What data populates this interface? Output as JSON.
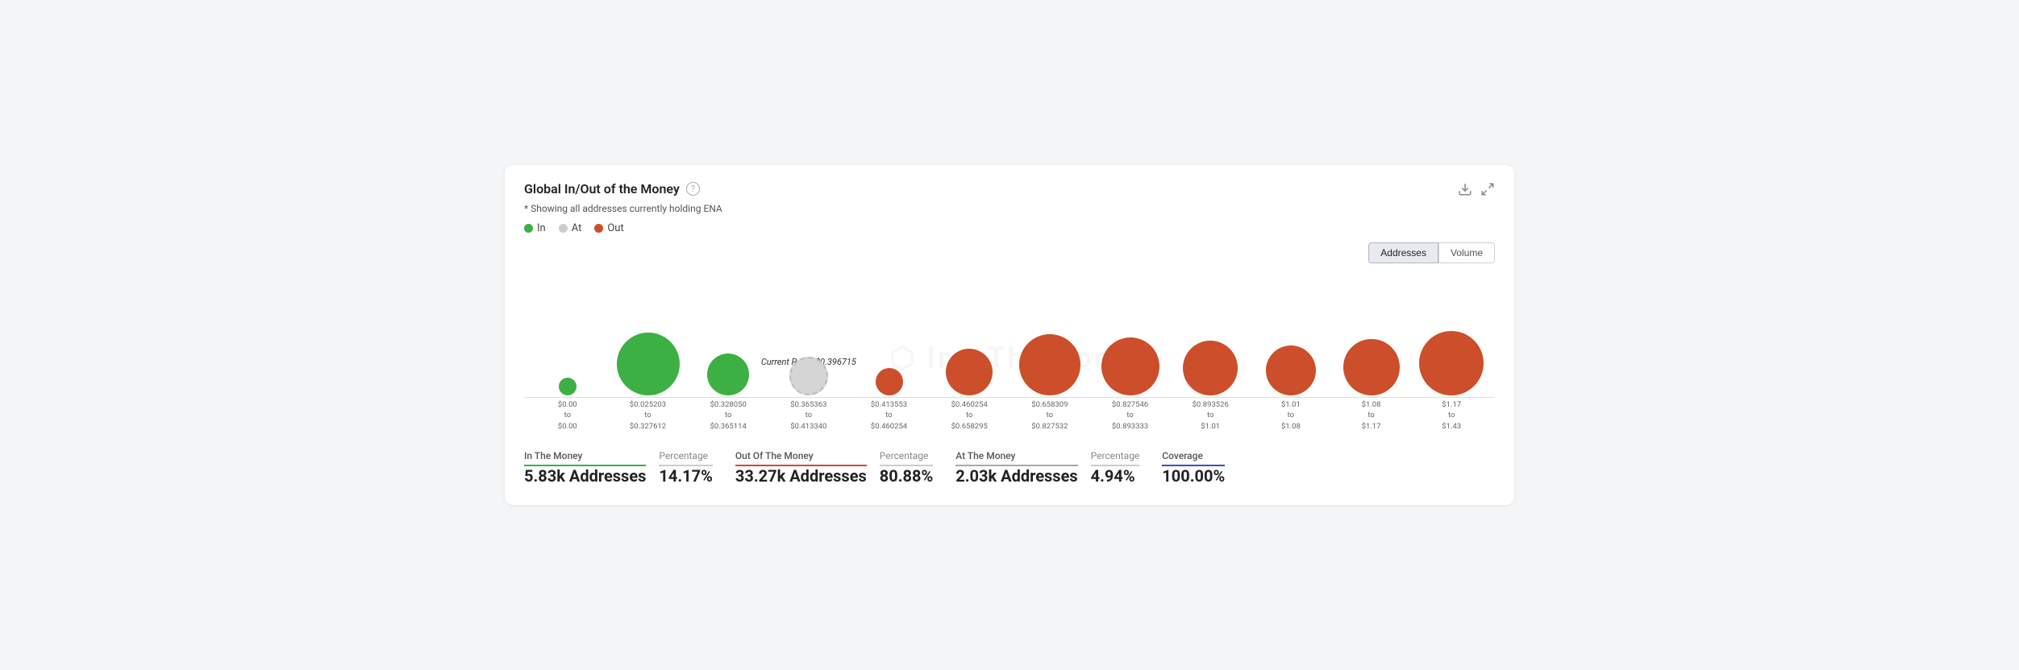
{
  "header": {
    "title": "Global In/Out of the Money",
    "subtitle": "* Showing all addresses currently holding ENA"
  },
  "legend": {
    "items": [
      {
        "label": "In",
        "color": "green"
      },
      {
        "label": "At",
        "color": "gray"
      },
      {
        "label": "Out",
        "color": "red"
      }
    ]
  },
  "tabs": {
    "options": [
      "Addresses",
      "Volume"
    ],
    "active": "Addresses"
  },
  "chart": {
    "current_price_label": "Current Price: $0.396715",
    "bubbles": [
      {
        "color": "green",
        "size": 22,
        "range_top": "$0.00",
        "range_bottom": "$0.00"
      },
      {
        "color": "green",
        "size": 78,
        "range_top": "$0.025203",
        "range_bottom": "$0.327612"
      },
      {
        "color": "green",
        "size": 52,
        "range_top": "$0.328050",
        "range_bottom": "$0.365114"
      },
      {
        "color": "gray",
        "size": 48,
        "range_top": "$0.365363",
        "range_bottom": "$0.413340",
        "price_col": true
      },
      {
        "color": "red",
        "size": 34,
        "range_top": "$0.413553",
        "range_bottom": "$0.460254"
      },
      {
        "color": "red",
        "size": 58,
        "range_top": "$0.460254",
        "range_bottom": "$0.658295"
      },
      {
        "color": "red",
        "size": 76,
        "range_top": "$0.658309",
        "range_bottom": "$0.827532"
      },
      {
        "color": "red",
        "size": 72,
        "range_top": "$0.827546",
        "range_bottom": "$0.893333"
      },
      {
        "color": "red",
        "size": 68,
        "range_top": "$0.893526",
        "range_bottom": "$1.01"
      },
      {
        "color": "red",
        "size": 62,
        "range_top": "$1.01",
        "range_bottom": "$1.08"
      },
      {
        "color": "red",
        "size": 70,
        "range_top": "$1.08",
        "range_bottom": "$1.17"
      },
      {
        "color": "red",
        "size": 80,
        "range_top": "$1.17",
        "range_bottom": "$1.43"
      }
    ],
    "x_labels": [
      {
        "line1": "$0.00",
        "line2": "to",
        "line3": "$0.00"
      },
      {
        "line1": "$0.025203",
        "line2": "to",
        "line3": "$0.327612"
      },
      {
        "line1": "$0.328050",
        "line2": "to",
        "line3": "$0.365114"
      },
      {
        "line1": "$0.365363",
        "line2": "to",
        "line3": "$0.413340"
      },
      {
        "line1": "$0.413553",
        "line2": "to",
        "line3": "$0.460254"
      },
      {
        "line1": "$0.460254",
        "line2": "to",
        "line3": "$0.658295"
      },
      {
        "line1": "$0.658309",
        "line2": "to",
        "line3": "$0.827532"
      },
      {
        "line1": "$0.827546",
        "line2": "to",
        "line3": "$0.893333"
      },
      {
        "line1": "$0.893526",
        "line2": "to",
        "line3": "$1.01"
      },
      {
        "line1": "$1.01",
        "line2": "to",
        "line3": "$1.08"
      },
      {
        "line1": "$1.08",
        "line2": "to",
        "line3": "$1.17"
      },
      {
        "line1": "$1.17",
        "line2": "to",
        "line3": "$1.43"
      }
    ]
  },
  "stats": {
    "in_the_money": {
      "label": "In The Money",
      "value": "5.83k Addresses",
      "percentage_label": "Percentage",
      "percentage": "14.17%"
    },
    "out_of_the_money": {
      "label": "Out Of The Money",
      "value": "33.27k Addresses",
      "percentage_label": "Percentage",
      "percentage": "80.88%"
    },
    "at_the_money": {
      "label": "At The Money",
      "value": "2.03k Addresses",
      "percentage_label": "Percentage",
      "percentage": "4.94%"
    },
    "coverage": {
      "label": "Coverage",
      "value": "100.00%"
    }
  }
}
